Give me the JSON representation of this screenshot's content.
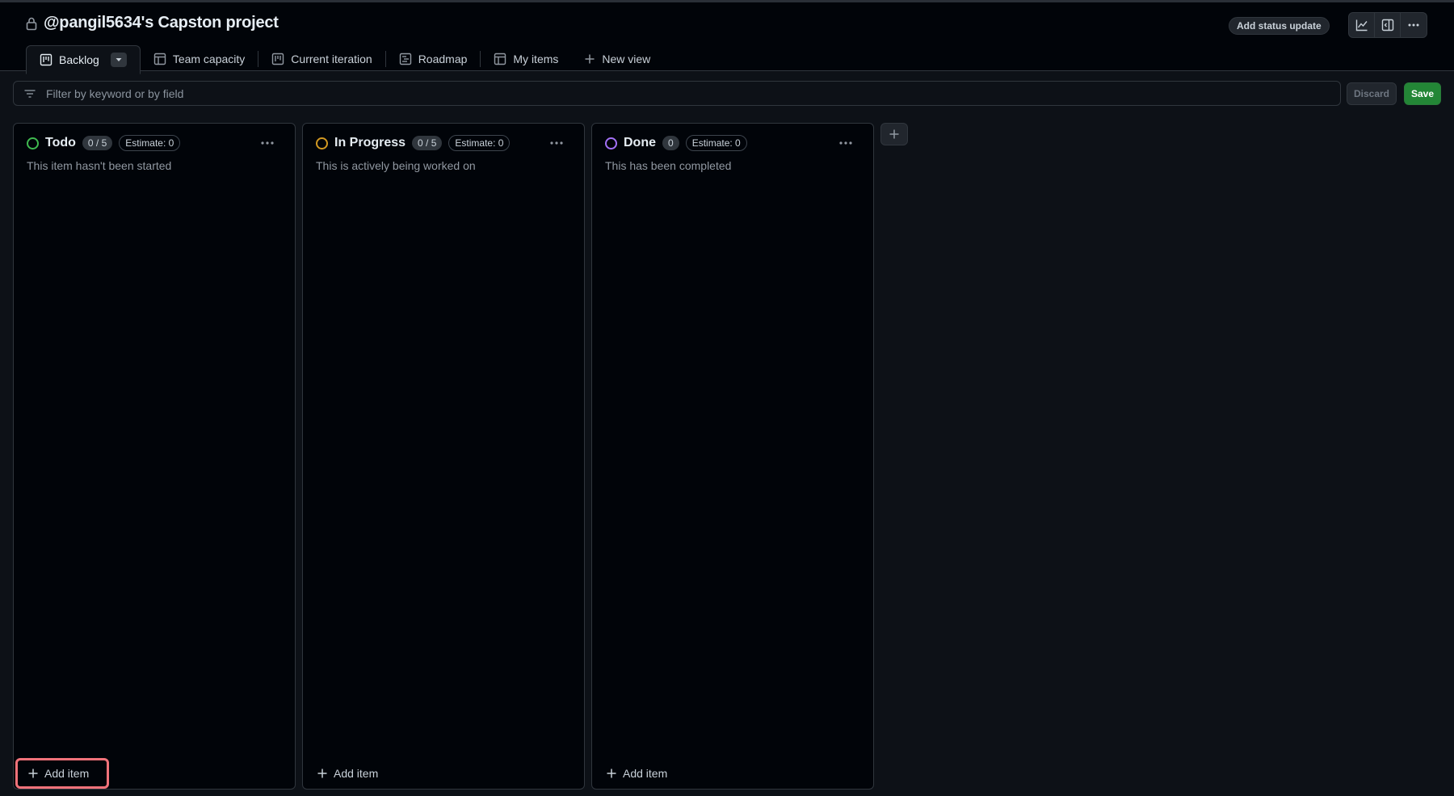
{
  "project": {
    "title": "@pangil5634's Capston project"
  },
  "header": {
    "status_update_label": "Add status update",
    "tools": [
      {
        "icon": "insights-graph-icon"
      },
      {
        "icon": "side-panel-icon"
      },
      {
        "icon": "kebab-horizontal-icon"
      }
    ]
  },
  "tabs": [
    {
      "label": "Backlog",
      "icon": "board-icon",
      "active": true
    },
    {
      "label": "Team capacity",
      "icon": "table-icon"
    },
    {
      "label": "Current iteration",
      "icon": "board-icon"
    },
    {
      "label": "Roadmap",
      "icon": "roadmap-icon"
    },
    {
      "label": "My items",
      "icon": "table-icon"
    },
    {
      "label": "New view",
      "icon": "plus-icon"
    }
  ],
  "filter": {
    "placeholder": "Filter by keyword or by field",
    "value": ""
  },
  "actions": {
    "discard_label": "Discard",
    "save_label": "Save"
  },
  "columns": [
    {
      "name": "Todo",
      "count": "0 / 5",
      "estimate": "Estimate: 0",
      "description": "This item hasn't been started",
      "color": "#3fb950",
      "add_label": "Add item"
    },
    {
      "name": "In Progress",
      "count": "0 / 5",
      "estimate": "Estimate: 0",
      "description": "This is actively being worked on",
      "color": "#d29922",
      "add_label": "Add item"
    },
    {
      "name": "Done",
      "count": "0",
      "estimate": "Estimate: 0",
      "description": "This has been completed",
      "color": "#a371f7",
      "add_label": "Add item"
    }
  ],
  "colors": {
    "background": "#0d1117",
    "accent_save": "#238636",
    "highlight": "#f0727a"
  }
}
